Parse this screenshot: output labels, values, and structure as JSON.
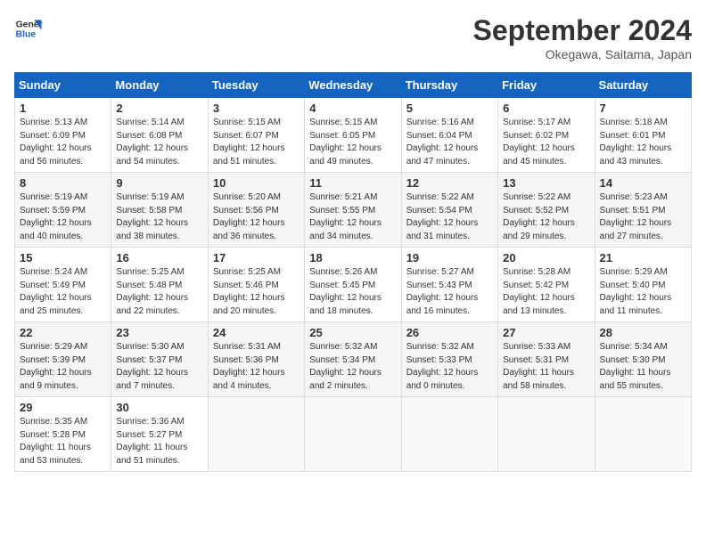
{
  "logo": {
    "line1": "General",
    "line2": "Blue"
  },
  "title": "September 2024",
  "location": "Okegawa, Saitama, Japan",
  "days_of_week": [
    "Sunday",
    "Monday",
    "Tuesday",
    "Wednesday",
    "Thursday",
    "Friday",
    "Saturday"
  ],
  "weeks": [
    [
      {
        "day": "1",
        "lines": [
          "Sunrise: 5:13 AM",
          "Sunset: 6:09 PM",
          "Daylight: 12 hours",
          "and 56 minutes."
        ]
      },
      {
        "day": "2",
        "lines": [
          "Sunrise: 5:14 AM",
          "Sunset: 6:08 PM",
          "Daylight: 12 hours",
          "and 54 minutes."
        ]
      },
      {
        "day": "3",
        "lines": [
          "Sunrise: 5:15 AM",
          "Sunset: 6:07 PM",
          "Daylight: 12 hours",
          "and 51 minutes."
        ]
      },
      {
        "day": "4",
        "lines": [
          "Sunrise: 5:15 AM",
          "Sunset: 6:05 PM",
          "Daylight: 12 hours",
          "and 49 minutes."
        ]
      },
      {
        "day": "5",
        "lines": [
          "Sunrise: 5:16 AM",
          "Sunset: 6:04 PM",
          "Daylight: 12 hours",
          "and 47 minutes."
        ]
      },
      {
        "day": "6",
        "lines": [
          "Sunrise: 5:17 AM",
          "Sunset: 6:02 PM",
          "Daylight: 12 hours",
          "and 45 minutes."
        ]
      },
      {
        "day": "7",
        "lines": [
          "Sunrise: 5:18 AM",
          "Sunset: 6:01 PM",
          "Daylight: 12 hours",
          "and 43 minutes."
        ]
      }
    ],
    [
      {
        "day": "8",
        "lines": [
          "Sunrise: 5:19 AM",
          "Sunset: 5:59 PM",
          "Daylight: 12 hours",
          "and 40 minutes."
        ]
      },
      {
        "day": "9",
        "lines": [
          "Sunrise: 5:19 AM",
          "Sunset: 5:58 PM",
          "Daylight: 12 hours",
          "and 38 minutes."
        ]
      },
      {
        "day": "10",
        "lines": [
          "Sunrise: 5:20 AM",
          "Sunset: 5:56 PM",
          "Daylight: 12 hours",
          "and 36 minutes."
        ]
      },
      {
        "day": "11",
        "lines": [
          "Sunrise: 5:21 AM",
          "Sunset: 5:55 PM",
          "Daylight: 12 hours",
          "and 34 minutes."
        ]
      },
      {
        "day": "12",
        "lines": [
          "Sunrise: 5:22 AM",
          "Sunset: 5:54 PM",
          "Daylight: 12 hours",
          "and 31 minutes."
        ]
      },
      {
        "day": "13",
        "lines": [
          "Sunrise: 5:22 AM",
          "Sunset: 5:52 PM",
          "Daylight: 12 hours",
          "and 29 minutes."
        ]
      },
      {
        "day": "14",
        "lines": [
          "Sunrise: 5:23 AM",
          "Sunset: 5:51 PM",
          "Daylight: 12 hours",
          "and 27 minutes."
        ]
      }
    ],
    [
      {
        "day": "15",
        "lines": [
          "Sunrise: 5:24 AM",
          "Sunset: 5:49 PM",
          "Daylight: 12 hours",
          "and 25 minutes."
        ]
      },
      {
        "day": "16",
        "lines": [
          "Sunrise: 5:25 AM",
          "Sunset: 5:48 PM",
          "Daylight: 12 hours",
          "and 22 minutes."
        ]
      },
      {
        "day": "17",
        "lines": [
          "Sunrise: 5:25 AM",
          "Sunset: 5:46 PM",
          "Daylight: 12 hours",
          "and 20 minutes."
        ]
      },
      {
        "day": "18",
        "lines": [
          "Sunrise: 5:26 AM",
          "Sunset: 5:45 PM",
          "Daylight: 12 hours",
          "and 18 minutes."
        ]
      },
      {
        "day": "19",
        "lines": [
          "Sunrise: 5:27 AM",
          "Sunset: 5:43 PM",
          "Daylight: 12 hours",
          "and 16 minutes."
        ]
      },
      {
        "day": "20",
        "lines": [
          "Sunrise: 5:28 AM",
          "Sunset: 5:42 PM",
          "Daylight: 12 hours",
          "and 13 minutes."
        ]
      },
      {
        "day": "21",
        "lines": [
          "Sunrise: 5:29 AM",
          "Sunset: 5:40 PM",
          "Daylight: 12 hours",
          "and 11 minutes."
        ]
      }
    ],
    [
      {
        "day": "22",
        "lines": [
          "Sunrise: 5:29 AM",
          "Sunset: 5:39 PM",
          "Daylight: 12 hours",
          "and 9 minutes."
        ]
      },
      {
        "day": "23",
        "lines": [
          "Sunrise: 5:30 AM",
          "Sunset: 5:37 PM",
          "Daylight: 12 hours",
          "and 7 minutes."
        ]
      },
      {
        "day": "24",
        "lines": [
          "Sunrise: 5:31 AM",
          "Sunset: 5:36 PM",
          "Daylight: 12 hours",
          "and 4 minutes."
        ]
      },
      {
        "day": "25",
        "lines": [
          "Sunrise: 5:32 AM",
          "Sunset: 5:34 PM",
          "Daylight: 12 hours",
          "and 2 minutes."
        ]
      },
      {
        "day": "26",
        "lines": [
          "Sunrise: 5:32 AM",
          "Sunset: 5:33 PM",
          "Daylight: 12 hours",
          "and 0 minutes."
        ]
      },
      {
        "day": "27",
        "lines": [
          "Sunrise: 5:33 AM",
          "Sunset: 5:31 PM",
          "Daylight: 11 hours",
          "and 58 minutes."
        ]
      },
      {
        "day": "28",
        "lines": [
          "Sunrise: 5:34 AM",
          "Sunset: 5:30 PM",
          "Daylight: 11 hours",
          "and 55 minutes."
        ]
      }
    ],
    [
      {
        "day": "29",
        "lines": [
          "Sunrise: 5:35 AM",
          "Sunset: 5:28 PM",
          "Daylight: 11 hours",
          "and 53 minutes."
        ]
      },
      {
        "day": "30",
        "lines": [
          "Sunrise: 5:36 AM",
          "Sunset: 5:27 PM",
          "Daylight: 11 hours",
          "and 51 minutes."
        ]
      },
      {
        "day": "",
        "lines": []
      },
      {
        "day": "",
        "lines": []
      },
      {
        "day": "",
        "lines": []
      },
      {
        "day": "",
        "lines": []
      },
      {
        "day": "",
        "lines": []
      }
    ]
  ]
}
